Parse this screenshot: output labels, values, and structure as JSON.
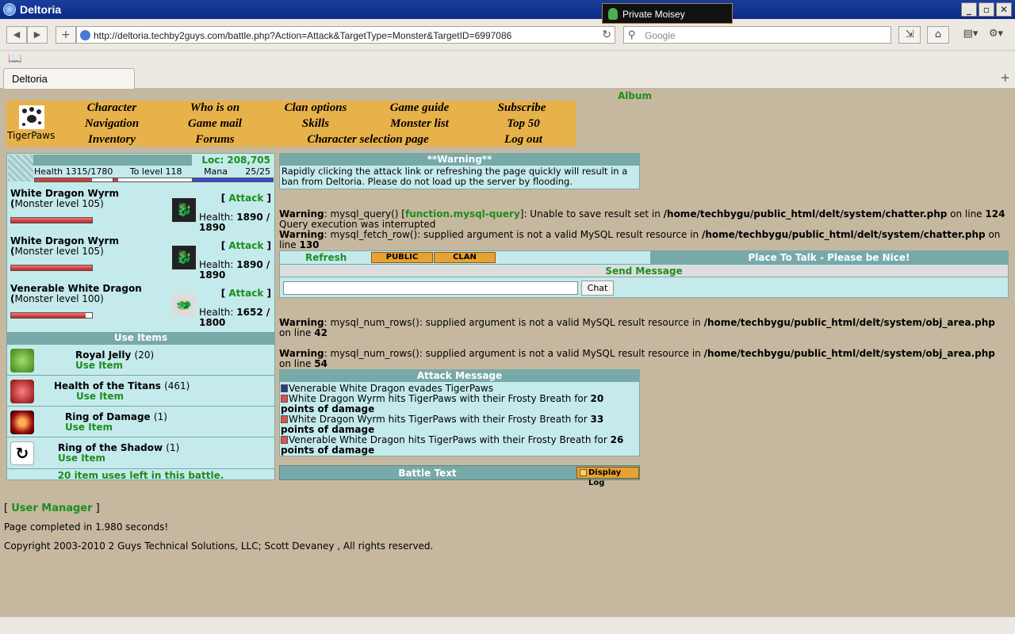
{
  "browser": {
    "window_title": "Deltoria",
    "notification": "Private Moisey",
    "url": "http://deltoria.techby2guys.com/battle.php?Action=Attack&TargetType=Monster&TargetID=6997086",
    "search_placeholder": "Google",
    "tab_title": "Deltoria"
  },
  "album_link": "Album",
  "character_name": "TigerPaws",
  "menu": {
    "col1": [
      "Character",
      "Navigation",
      "Inventory"
    ],
    "col2": [
      "Who is on",
      "Game mail",
      "Forums"
    ],
    "col3": [
      "Clan options",
      "Skills",
      "Character selection page"
    ],
    "col4": [
      "Game guide",
      "Monster list"
    ],
    "col5": [
      "Subscribe",
      "Top 50",
      "Log out"
    ]
  },
  "status": {
    "loc": "Loc: 208,705",
    "health_label": "Health",
    "health_value": "1315/1780",
    "to_level": "To level 118",
    "mana_label": "Mana",
    "mana_value": "25/25",
    "health_fraction": 0.739,
    "to_level_fraction": 0.05,
    "mana_fraction": 1.0
  },
  "monsters": [
    {
      "name": "White Dragon Wyrm (",
      "detail": "Monster level 105)",
      "attack": "Attack",
      "health_label": "Health:",
      "health": "1890 / 1890",
      "health_fraction": 1.0
    },
    {
      "name": "White Dragon Wyrm (",
      "detail": "Monster level 105)",
      "attack": "Attack",
      "health_label": "Health:",
      "health": "1890 / 1890",
      "health_fraction": 1.0
    },
    {
      "name": "Venerable White Dragon (",
      "detail": "Monster level 100)",
      "attack": "Attack",
      "health_label": "Health:",
      "health": "1652 / 1800",
      "health_fraction": 0.918
    }
  ],
  "use_items_header": "Use Items",
  "items": [
    {
      "name": "Royal Jelly",
      "count": "(20)",
      "use": "Use Item",
      "icon": "jelly-icon"
    },
    {
      "name": "Health of the Titans",
      "count": "(461)",
      "use": "Use Item",
      "icon": "potion-icon"
    },
    {
      "name": "Ring of Damage",
      "count": "(1)",
      "use": "Use Item",
      "icon": "ring-damage-icon"
    },
    {
      "name": "Ring of the Shadow",
      "count": "(1)",
      "use": "Use Item",
      "icon": "ring-shadow-icon"
    }
  ],
  "uses_left": "20 item uses left in this battle.",
  "warning_box": {
    "title": "**Warning**",
    "text": "Rapidly clicking the attack link or refreshing the page quickly will result in a ban from Deltoria. Please do not load up the server by flooding."
  },
  "php_warnings": {
    "w1_label": "Warning",
    "w1_a": ": mysql_query() [",
    "w1_link": "function.mysql-query",
    "w1_b": "]: Unable to save result set in ",
    "w1_path": "/home/techbygu/public_html/delt/system/chatter.php",
    "w1_c": " on line ",
    "w1_line": "124",
    "w2": "Query execution was interrupted",
    "w3_label": "Warning",
    "w3_a": ": mysql_fetch_row(): supplied argument is not a valid MySQL result resource in ",
    "w3_path": "/home/techbygu/public_html/delt/system/chatter.php",
    "w3_c": " on line ",
    "w3_line": "130",
    "w4_label": "Warning",
    "w4_a": ": mysql_num_rows(): supplied argument is not a valid MySQL result resource in ",
    "w4_path": "/home/techbygu/public_html/delt/system/obj_area.php",
    "w4_c": " on line ",
    "w4_line": "42",
    "w5_label": "Warning",
    "w5_a": ": mysql_num_rows(): supplied argument is not a valid MySQL result resource in ",
    "w5_path": "/home/techbygu/public_html/delt/system/obj_area.php",
    "w5_c": " on line ",
    "w5_line": "54"
  },
  "chat": {
    "refresh": "Refresh",
    "tab_public": "PUBLIC",
    "tab_clan": "CLAN",
    "place": "Place To Talk - Please be Nice!",
    "send_message": "Send Message",
    "button": "Chat"
  },
  "attack_message": {
    "title": "Attack Message",
    "line1": "Venerable White Dragon evades TigerPaws",
    "line2_a": "White Dragon Wyrm hits TigerPaws with their Frosty Breath for ",
    "line2_b": "20 points of damage",
    "line3_a": "White Dragon Wyrm hits TigerPaws with their Frosty Breath for ",
    "line3_b": "33 points of damage",
    "line4_a": "Venerable White Dragon hits TigerPaws with their Frosty Breath for ",
    "line4_b": "26 points of damage"
  },
  "battle_text": "Battle Text",
  "display_log": "Display Log",
  "footer": {
    "user_manager": "User Manager",
    "page_completed": "Page completed in 1.980 seconds!",
    "copyright": "Copyright 2003-2010 2 Guys Technical Solutions, LLC; Scott Devaney , All rights reserved."
  }
}
